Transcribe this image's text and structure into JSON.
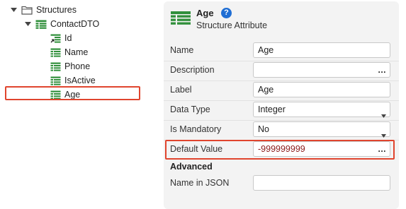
{
  "tree": {
    "root": "Structures",
    "structure": "ContactDTO",
    "attributes": [
      "Id",
      "Name",
      "Phone",
      "IsActive",
      "Age"
    ],
    "selected": "Age"
  },
  "panel": {
    "title": "Age",
    "help": "?",
    "subtitle": "Structure Attribute",
    "fields": {
      "name": {
        "label": "Name",
        "value": "Age"
      },
      "description": {
        "label": "Description",
        "value": "",
        "button": "..."
      },
      "label": {
        "label": "Label",
        "value": "Age"
      },
      "data_type": {
        "label": "Data Type",
        "value": "Integer"
      },
      "is_mandatory": {
        "label": "Is Mandatory",
        "value": "No"
      },
      "default_value": {
        "label": "Default Value",
        "value": "-999999999",
        "button": "..."
      }
    },
    "advanced": {
      "title": "Advanced",
      "name_in_json": {
        "label": "Name in JSON",
        "value": ""
      }
    }
  },
  "colors": {
    "accent": "#1f6ed4",
    "highlight": "#e0452e",
    "entity": "#2f8f3a"
  }
}
